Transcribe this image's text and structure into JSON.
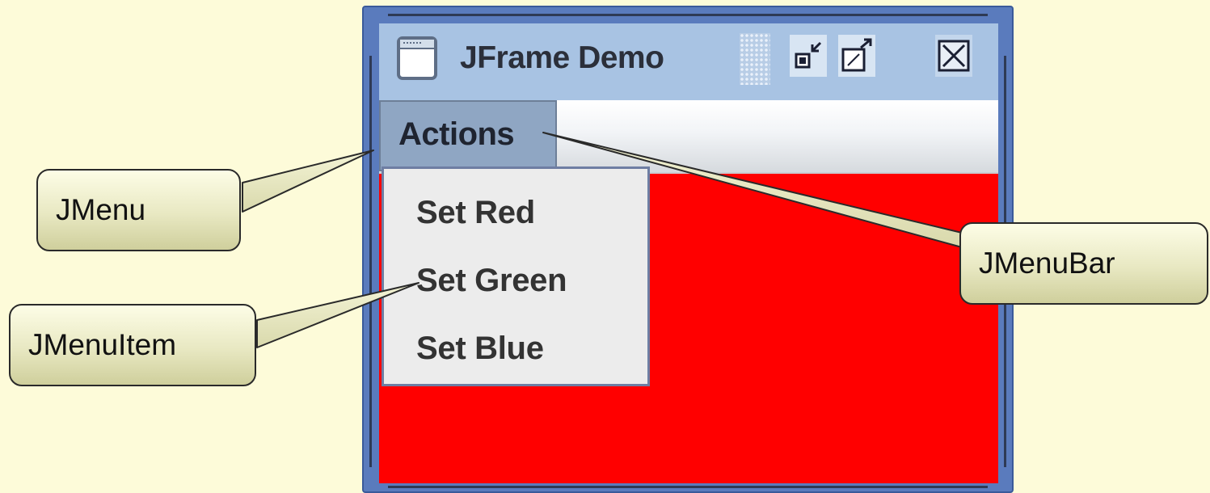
{
  "window": {
    "title": "JFrame Demo",
    "icons": {
      "frame_icon": "window-icon",
      "minimize": "minimize-icon",
      "maximize": "maximize-icon",
      "close": "close-icon"
    }
  },
  "menubar": {
    "menu_label": "Actions"
  },
  "popup": {
    "items": [
      "Set Red",
      "Set Green",
      "Set Blue"
    ]
  },
  "content": {
    "background_color": "#ff0000"
  },
  "callouts": {
    "jmenu": "JMenu",
    "jmenuitem": "JMenuItem",
    "jmenubar": "JMenuBar"
  },
  "colors": {
    "page_background": "#fdfbd9",
    "title_bar": "#a8c3e3",
    "menu_highlight": "#8fa6c3",
    "popup_background": "#ececec"
  }
}
